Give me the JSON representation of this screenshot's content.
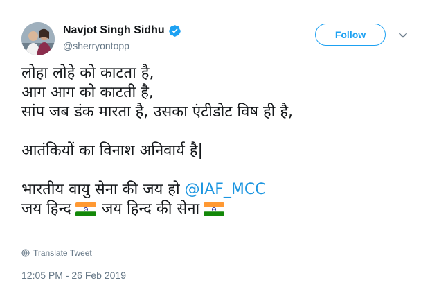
{
  "user": {
    "display_name": "Navjot Singh Sidhu",
    "handle": "@sherryontopp",
    "verified": true
  },
  "actions": {
    "follow_label": "Follow"
  },
  "tweet": {
    "lines": [
      "लोहा लोहे को काटता है,",
      "आग आग को काटती है,",
      "सांप जब डंक मारता है, उसका एंटीडोट विष ही है,",
      "",
      "आतंकियों का विनाश अनिवार्य है|",
      "",
      "भारतीय वायु सेना की जय हो"
    ],
    "mention": "@IAF_MCC",
    "last_line_a": "जय हिन्द",
    "last_line_b": "जय हिन्द की सेना",
    "flag_icon": "india-flag-icon"
  },
  "footer": {
    "translate_label": "Translate Tweet",
    "timestamp": "12:05 PM - 26 Feb 2019"
  },
  "colors": {
    "link": "#1b95e0",
    "follow": "#1da1f2",
    "muted": "#657786",
    "text": "#14171a"
  }
}
